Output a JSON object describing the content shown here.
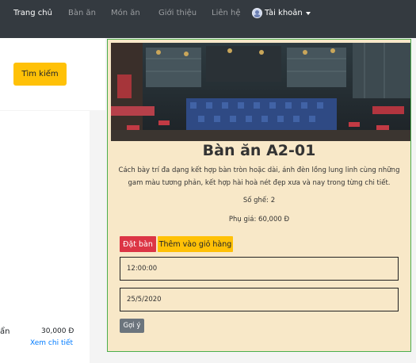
{
  "navbar": {
    "items": [
      {
        "label": "Trang chủ"
      },
      {
        "label": "Bàn ăn"
      },
      {
        "label": "Món ăn"
      },
      {
        "label": "Giới thiệu"
      },
      {
        "label": "Liên hệ"
      }
    ],
    "account_label": "Tài khoản",
    "account_icon": "user-avatar-icon",
    "caret_icon": "caret-down-icon"
  },
  "search": {
    "button_label": "Tìm kiếm"
  },
  "list_item": {
    "name_partial": "ẩn",
    "price": "30,000 Đ",
    "detail_link": "Xem chi tiết"
  },
  "detail": {
    "title": "Bàn ăn A2-01",
    "description": "Cách bày trí đa dạng kết hợp bàn tròn hoặc dài, ánh đèn lồng lung linh cùng những gam màu tương phản, kết hợp hài hoà nét đẹp xưa và nay trong từng chi tiết.",
    "seats": "Số ghế: 2",
    "surcharge": "Phụ giá: 60,000 Đ",
    "book_label": "Đặt bàn",
    "cart_label": "Thêm vào giỏ hàng",
    "time_value": "12:00:00",
    "date_value": "25/5/2020",
    "suggest_label": "Gợi ý"
  },
  "colors": {
    "navbar": "#343a40",
    "warning": "#ffc107",
    "danger": "#dc3545",
    "secondary": "#6c757d",
    "card_bg": "#f8e8c8",
    "card_border": "#4cae4c",
    "link": "#007bff"
  }
}
